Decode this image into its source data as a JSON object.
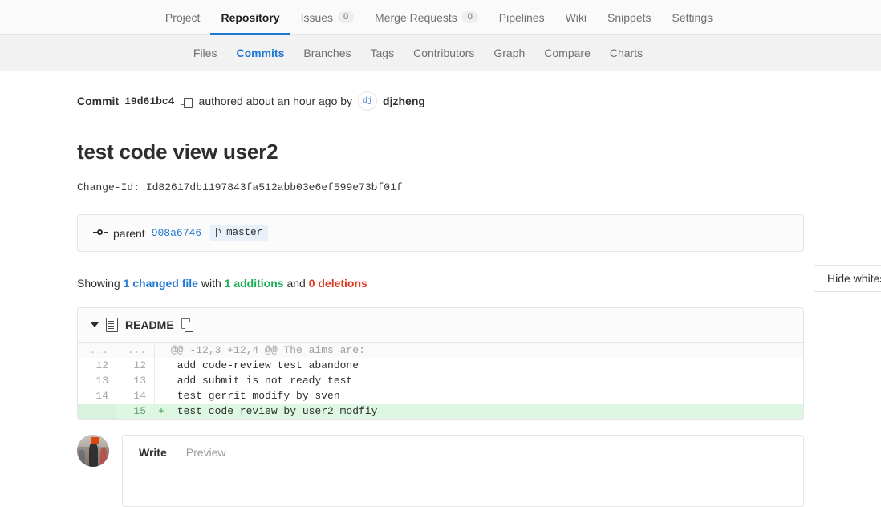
{
  "topnav": {
    "items": [
      {
        "label": "Project",
        "active": false,
        "count": null
      },
      {
        "label": "Repository",
        "active": true,
        "count": null
      },
      {
        "label": "Issues",
        "active": false,
        "count": "0"
      },
      {
        "label": "Merge Requests",
        "active": false,
        "count": "0"
      },
      {
        "label": "Pipelines",
        "active": false,
        "count": null
      },
      {
        "label": "Wiki",
        "active": false,
        "count": null
      },
      {
        "label": "Snippets",
        "active": false,
        "count": null
      },
      {
        "label": "Settings",
        "active": false,
        "count": null
      }
    ]
  },
  "subnav": {
    "items": [
      {
        "label": "Files",
        "active": false
      },
      {
        "label": "Commits",
        "active": true
      },
      {
        "label": "Branches",
        "active": false
      },
      {
        "label": "Tags",
        "active": false
      },
      {
        "label": "Contributors",
        "active": false
      },
      {
        "label": "Graph",
        "active": false
      },
      {
        "label": "Compare",
        "active": false
      },
      {
        "label": "Charts",
        "active": false
      }
    ]
  },
  "commit": {
    "label": "Commit",
    "sha": "19d61bc4",
    "copy_icon": "copy-icon",
    "authored_text": "authored about an hour ago by",
    "avatar_initials": "dj",
    "author": "djzheng",
    "title": "test code view user2",
    "change_id": "Change-Id: Id82617db1197843fa512abb03e6ef599e73bf01f"
  },
  "parent": {
    "icon": "commit-dot-icon",
    "label": "parent",
    "sha": "908a6746",
    "branch_icon": "branch-icon",
    "branch": "master"
  },
  "stats": {
    "showing": "Showing",
    "changed_files": "1 changed file",
    "with": "with",
    "additions": "1 additions",
    "and": "and",
    "deletions": "0 deletions",
    "hide_whitespace_label": "Hide whitespace changes",
    "color_blue": "#1f78d1",
    "color_green": "#1aaa55",
    "color_red": "#db3b21"
  },
  "diff": {
    "file_name": "README",
    "chevron_icon": "chevron-down-icon",
    "file_icon": "file-icon",
    "copy_path_icon": "copy-icon",
    "rows": [
      {
        "type": "meta",
        "old": "...",
        "new": "...",
        "marker": "",
        "code": "@@ -12,3 +12,4 @@ The aims are:"
      },
      {
        "type": "context",
        "old": "12",
        "new": "12",
        "marker": "",
        "code": " add code-review test abandone"
      },
      {
        "type": "context",
        "old": "13",
        "new": "13",
        "marker": "",
        "code": " add submit is not ready test"
      },
      {
        "type": "context",
        "old": "14",
        "new": "14",
        "marker": "",
        "code": " test gerrit modify by sven"
      },
      {
        "type": "added",
        "old": "",
        "new": "15",
        "marker": "+",
        "code": " test code review by user2 modfiy"
      }
    ]
  },
  "comment": {
    "avatar": "user-avatar",
    "tabs": [
      {
        "label": "Write",
        "active": true
      },
      {
        "label": "Preview",
        "active": false
      }
    ]
  }
}
